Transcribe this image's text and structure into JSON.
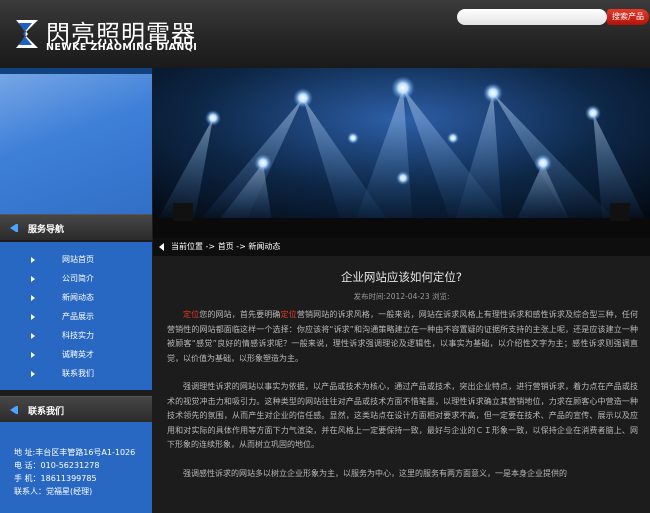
{
  "header": {
    "logo_cn": "閃亮照明電器",
    "logo_en": "NEWKE ZHAOMING DIANQI",
    "search_placeholder": "",
    "search_button": "搜索产品"
  },
  "nav": {
    "title": "服务导航",
    "items": [
      {
        "label": "网站首页"
      },
      {
        "label": "公司简介"
      },
      {
        "label": "新闻动态"
      },
      {
        "label": "产品展示"
      },
      {
        "label": "科技实力"
      },
      {
        "label": "诚聘英才"
      },
      {
        "label": "联系我们"
      }
    ]
  },
  "contact": {
    "title": "联系我们",
    "lines": [
      "地 址:丰台区丰管路16号A1-1026",
      "电 话：010-56231278",
      "手 机：18611399785",
      "联系人：党福星(经理)"
    ]
  },
  "breadcrumb": {
    "prefix": "当前位置",
    "sep1": " -> ",
    "home": "首页",
    "sep2": " -> ",
    "current": "新闻动态"
  },
  "article": {
    "title": "企业网站应该如何定位?",
    "meta": "发布时间:2012-04-23 浏览:",
    "p1_kw1": "定位",
    "p1_a": "您的网站，首先要明确",
    "p1_kw2": "定位",
    "p1_b": "营销网站的诉求风格，一般来说，网站在诉求风格上有理性诉求和感性诉求及综合型三种，任何营销性的网站都面临这样一个选择：你应该将“诉求”和沟通策略建立在一种由不容置疑的证据所支持的主张上呢，还是应该建立一种被顾客“感觉”良好的情感诉求呢？一般来说，理性诉求强调理论及逻辑性，以事实为基础，以介绍性文字为主；感性诉求则强调直觉，以价值为基础，以形象塑造为主。",
    "p2": "强调理性诉求的网站以事实为依据，以产品或技术为核心，通过产品或技术，突出企业特点，进行营销诉求，着力点在产品或技术的视觉冲击力和吸引力。这种类型的网站往往对产品或技术方面不惜笔墨，以理性诉求确立其营销地位，力求在顾客心中营造一种技术领先的氛围，从而产生对企业的信任感。显然，这类站点在设计方面相对要求不高，但一定要在技术、产品的宣传、展示以及应用和对实际的具体作用等方面下力气渲染，并在风格上一定要保持一致，最好与企业的ＣＩ形象一致，以保持企业在消费者脑上、网下形象的连续形象，从而树立巩固的地位。",
    "p3": "强调感性诉求的网站多以树立企业形象为主，以服务为中心，这里的服务有两方面意义，一是本身企业提供的"
  }
}
